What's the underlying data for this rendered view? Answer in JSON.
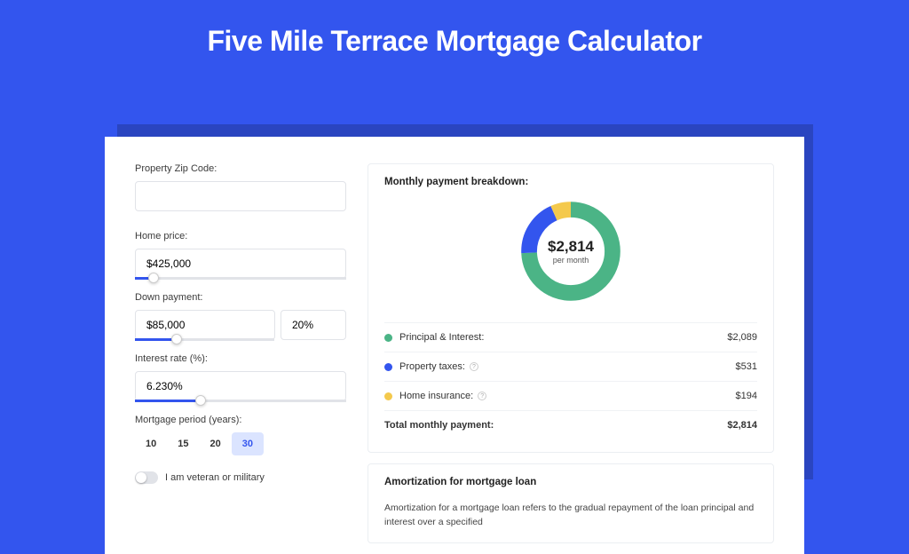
{
  "title": "Five Mile Terrace Mortgage Calculator",
  "form": {
    "zip_label": "Property Zip Code:",
    "zip_value": "",
    "home_price_label": "Home price:",
    "home_price_value": "$425,000",
    "home_price_slider_pct": 9,
    "down_label": "Down payment:",
    "down_value": "$85,000",
    "down_pct_value": "20%",
    "down_slider_pct": 20,
    "rate_label": "Interest rate (%):",
    "rate_value": "6.230%",
    "rate_slider_pct": 31,
    "period_label": "Mortgage period (years):",
    "periods": [
      "10",
      "15",
      "20",
      "30"
    ],
    "active_period_index": 3,
    "veteran_label": "I am veteran or military"
  },
  "breakdown": {
    "heading": "Monthly payment breakdown:",
    "donut_amount": "$2,814",
    "donut_sub": "per month",
    "pi_label": "Principal & Interest:",
    "pi_value": "$2,089",
    "tax_label": "Property taxes:",
    "tax_value": "$531",
    "ins_label": "Home insurance:",
    "ins_value": "$194",
    "total_label": "Total monthly payment:",
    "total_value": "$2,814",
    "colors": {
      "pi": "#4bb486",
      "tax": "#3355ee",
      "ins": "#f4c94c"
    }
  },
  "amortization": {
    "heading": "Amortization for mortgage loan",
    "text": "Amortization for a mortgage loan refers to the gradual repayment of the loan principal and interest over a specified"
  },
  "chart_data": {
    "type": "pie",
    "title": "Monthly payment breakdown",
    "series": [
      {
        "name": "Principal & Interest",
        "value": 2089,
        "color": "#4bb486"
      },
      {
        "name": "Property taxes",
        "value": 531,
        "color": "#3355ee"
      },
      {
        "name": "Home insurance",
        "value": 194,
        "color": "#f4c94c"
      }
    ],
    "total": 2814,
    "unit": "USD/month"
  }
}
